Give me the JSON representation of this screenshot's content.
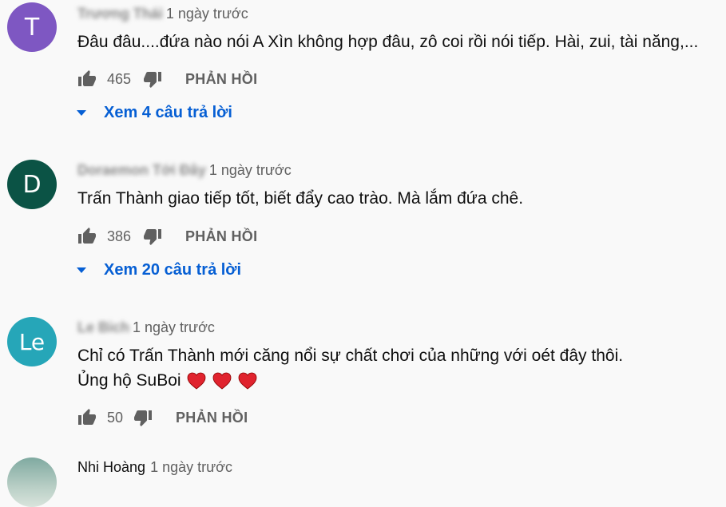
{
  "comments": [
    {
      "avatar_letter": "T",
      "avatar_color": "#7e57c2",
      "author": "Trương Thái",
      "time": "1 ngày trước",
      "text": "Đâu đâu....đứa nào nói A Xìn không hợp đâu, zô coi rồi nói tiếp. Hài, zui, tài năng,...",
      "likes": "465",
      "reply_label": "PHẢN HỒI",
      "replies_label": "Xem 4 câu trả lời"
    },
    {
      "avatar_letter": "D",
      "avatar_color": "#0b5345",
      "author": "Doraemon Tới Đây",
      "time": "1 ngày trước",
      "text": "Trấn Thành giao tiếp tốt, biết đẩy cao trào. Mà lắm đứa chê.",
      "likes": "386",
      "reply_label": "PHẢN HỒI",
      "replies_label": "Xem 20 câu trả lời"
    },
    {
      "avatar_letter": "Le",
      "avatar_color": "#26a6b8",
      "author": "Le Bich",
      "time": "1 ngày trước",
      "text_line1": "Chỉ có Trấn Thành mới căng nổi sự chất chơi của những với oét đây thôi.",
      "text_line2": "Ủng hộ SuBoi",
      "likes": "50",
      "reply_label": "PHẢN HỒI"
    },
    {
      "author": "Nhi Hoàng",
      "time": "1 ngày trước"
    }
  ],
  "colors": {
    "link": "#065fd4",
    "secondary": "#606060",
    "heart": "#e0232e"
  },
  "icons": {
    "like": "thumb-up-icon",
    "dislike": "thumb-down-icon",
    "heart": "heart-icon",
    "expand": "triangle-down-icon"
  }
}
